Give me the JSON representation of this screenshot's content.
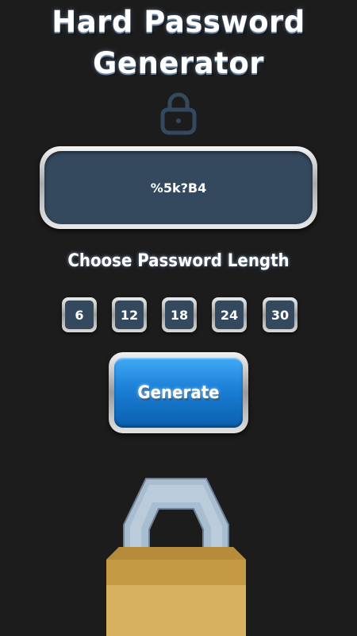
{
  "app": {
    "title_line1": "Hard Password",
    "title_line2": "Generator"
  },
  "password": {
    "value": "%5k?B4"
  },
  "length": {
    "label": "Choose Password Length",
    "options": [
      "6",
      "12",
      "18",
      "24",
      "30"
    ]
  },
  "generate": {
    "label": "Generate"
  },
  "icons": {
    "header_icon": "lock-icon",
    "footer_illustration": "padlock-illustration"
  },
  "colors": {
    "background": "#1c1c1c",
    "panel": "#34495e",
    "button_blue": "#1a7fd6",
    "padlock_body": "#c9a24a",
    "shackle": "#a9bdd1"
  }
}
